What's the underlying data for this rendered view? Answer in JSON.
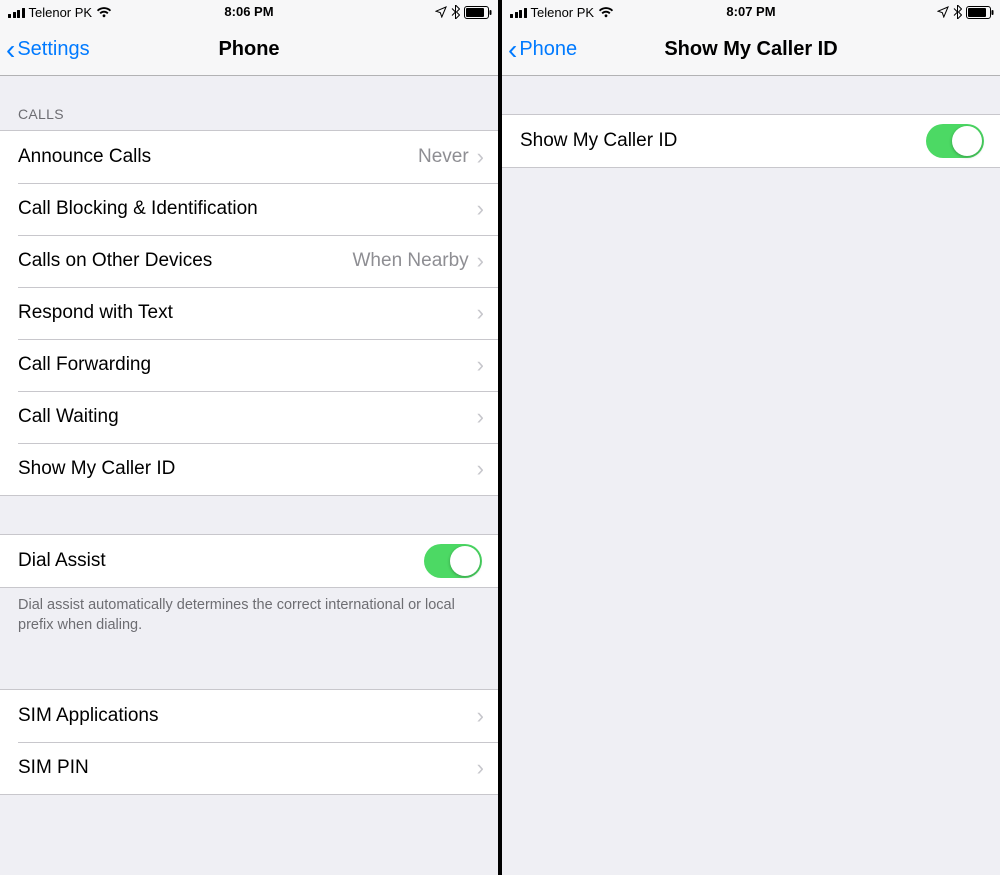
{
  "left": {
    "status": {
      "carrier": "Telenor PK",
      "time": "8:06 PM"
    },
    "nav": {
      "back": "Settings",
      "title": "Phone"
    },
    "calls_header": "CALLS",
    "calls": [
      {
        "label": "Announce Calls",
        "value": "Never"
      },
      {
        "label": "Call Blocking & Identification",
        "value": ""
      },
      {
        "label": "Calls on Other Devices",
        "value": "When Nearby"
      },
      {
        "label": "Respond with Text",
        "value": ""
      },
      {
        "label": "Call Forwarding",
        "value": ""
      },
      {
        "label": "Call Waiting",
        "value": ""
      },
      {
        "label": "Show My Caller ID",
        "value": ""
      }
    ],
    "dial_assist": {
      "label": "Dial Assist",
      "on": true,
      "footer": "Dial assist automatically determines the correct international or local prefix when dialing."
    },
    "sim": [
      {
        "label": "SIM Applications"
      },
      {
        "label": "SIM PIN"
      }
    ]
  },
  "right": {
    "status": {
      "carrier": "Telenor PK",
      "time": "8:07 PM"
    },
    "nav": {
      "back": "Phone",
      "title": "Show My Caller ID"
    },
    "row": {
      "label": "Show My Caller ID",
      "on": true
    }
  }
}
